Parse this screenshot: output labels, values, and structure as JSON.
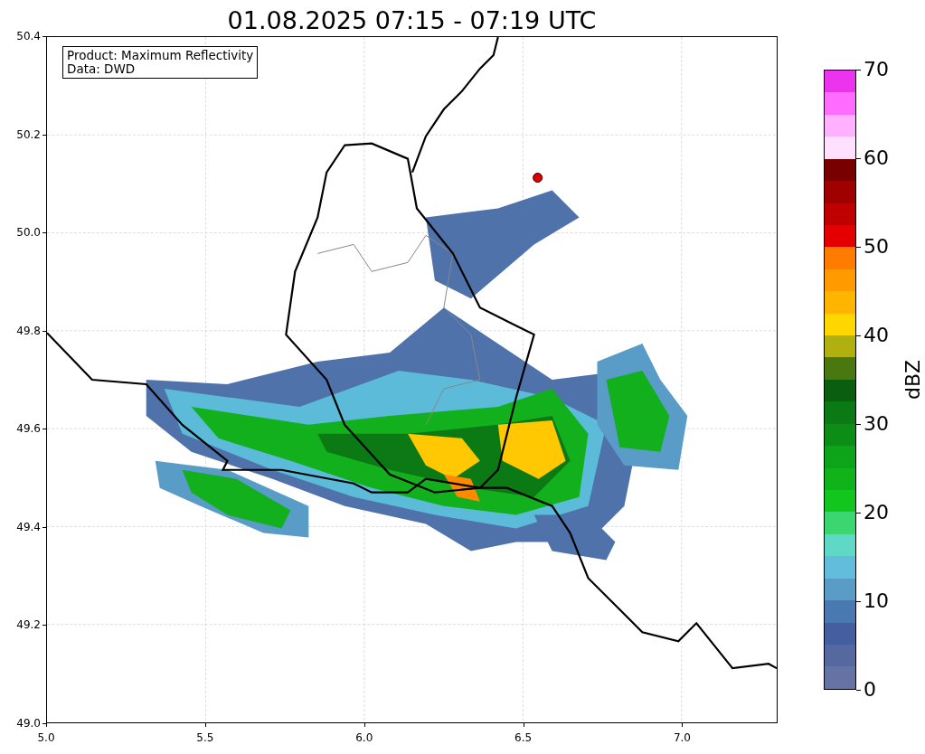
{
  "title": "01.08.2025 07:15 - 07:19 UTC",
  "legend": {
    "lines": [
      "Product: Maximum Reflectivity",
      "Data: DWD"
    ]
  },
  "y_ticks": [
    "50.4",
    "50.2",
    "50.0",
    "49.8",
    "49.6",
    "49.4",
    "49.2",
    "49.0"
  ],
  "x_ticks": [
    "5.0",
    "5.5",
    "6.0",
    "6.5",
    "7.0"
  ],
  "colorbar": {
    "label": "dBZ",
    "ticks": [
      "70",
      "60",
      "50",
      "40",
      "30",
      "20",
      "10",
      "0"
    ],
    "segments": [
      {
        "color": "#ee33ee"
      },
      {
        "color": "#ff6cff"
      },
      {
        "color": "#ffb0ff"
      },
      {
        "color": "#ffe0ff"
      },
      {
        "color": "#780000"
      },
      {
        "color": "#a00000"
      },
      {
        "color": "#c00000"
      },
      {
        "color": "#e40000"
      },
      {
        "color": "#ff7c00"
      },
      {
        "color": "#ff9a00"
      },
      {
        "color": "#ffb400"
      },
      {
        "color": "#ffd700"
      },
      {
        "color": "#b0b010"
      },
      {
        "color": "#4a7810"
      },
      {
        "color": "#0a5e10"
      },
      {
        "color": "#0b7a14"
      },
      {
        "color": "#0c8e16"
      },
      {
        "color": "#0ea41a"
      },
      {
        "color": "#10b41a"
      },
      {
        "color": "#12c61e"
      },
      {
        "color": "#3cd670"
      },
      {
        "color": "#60d8c6"
      },
      {
        "color": "#62bcdc"
      },
      {
        "color": "#5a9cc8"
      },
      {
        "color": "#4a78b0"
      },
      {
        "color": "#455ea0"
      },
      {
        "color": "#55689f"
      },
      {
        "color": "#6473a3"
      }
    ]
  }
}
